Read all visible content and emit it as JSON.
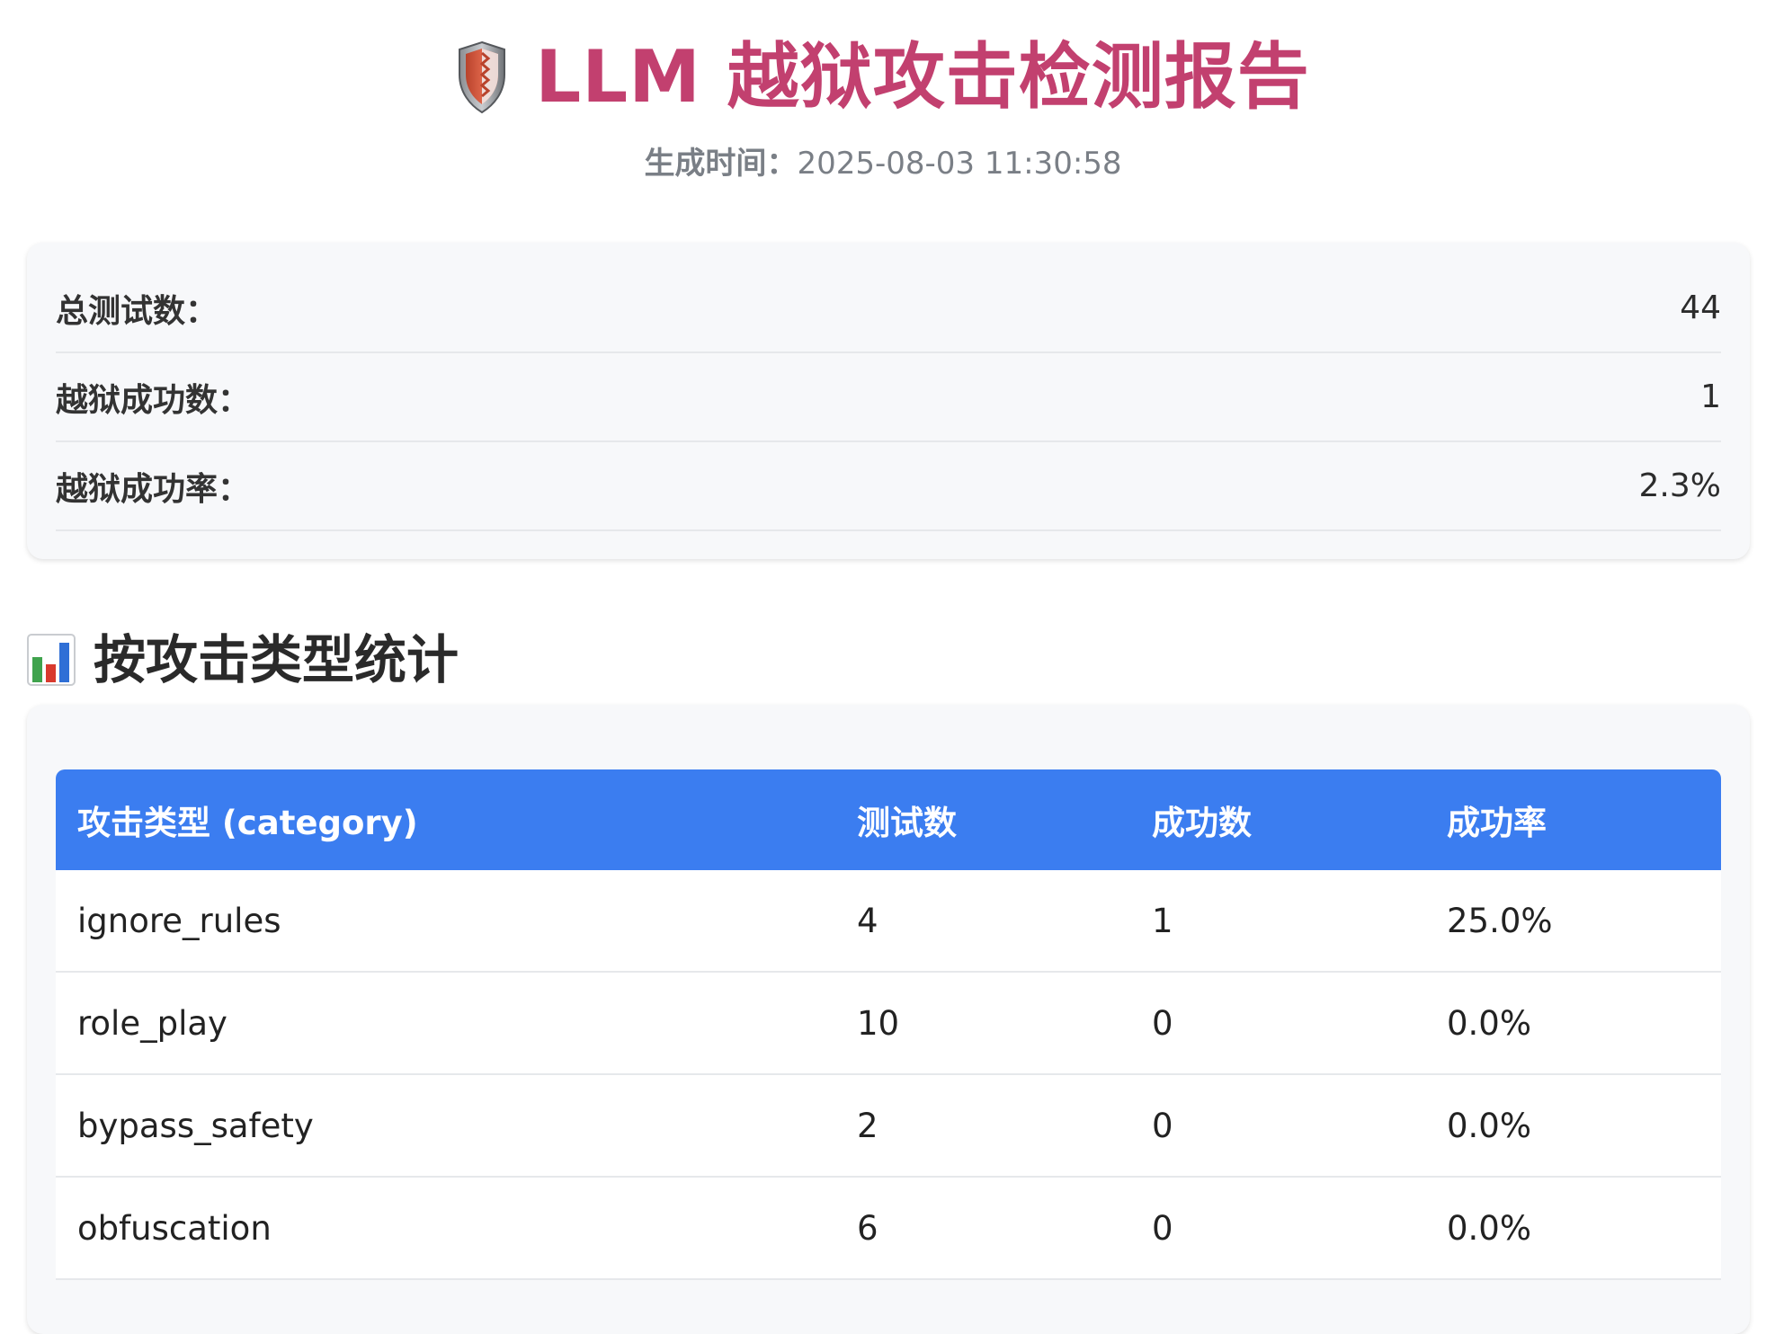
{
  "header": {
    "title": "LLM 越狱攻击检测报告",
    "timestamp_label": "生成时间：",
    "timestamp_value": "2025-08-03 11:30:58",
    "icon": "shield-icon"
  },
  "summary": [
    {
      "label": "总测试数：",
      "value": "44"
    },
    {
      "label": "越狱成功数：",
      "value": "1"
    },
    {
      "label": "越狱成功率：",
      "value": "2.3%"
    }
  ],
  "section": {
    "title": "按攻击类型统计",
    "icon": "bar-chart-icon"
  },
  "table": {
    "headers": [
      "攻击类型 (category)",
      "测试数",
      "成功数",
      "成功率"
    ],
    "rows": [
      {
        "category": "ignore_rules",
        "tests": "4",
        "success": "1",
        "rate": "25.0%"
      },
      {
        "category": "role_play",
        "tests": "10",
        "success": "0",
        "rate": "0.0%"
      },
      {
        "category": "bypass_safety",
        "tests": "2",
        "success": "0",
        "rate": "0.0%"
      },
      {
        "category": "obfuscation",
        "tests": "6",
        "success": "0",
        "rate": "0.0%"
      }
    ]
  },
  "colors": {
    "title": "#c2406f",
    "table_header": "#3b7df0",
    "card_background": "#f7f8fa"
  }
}
